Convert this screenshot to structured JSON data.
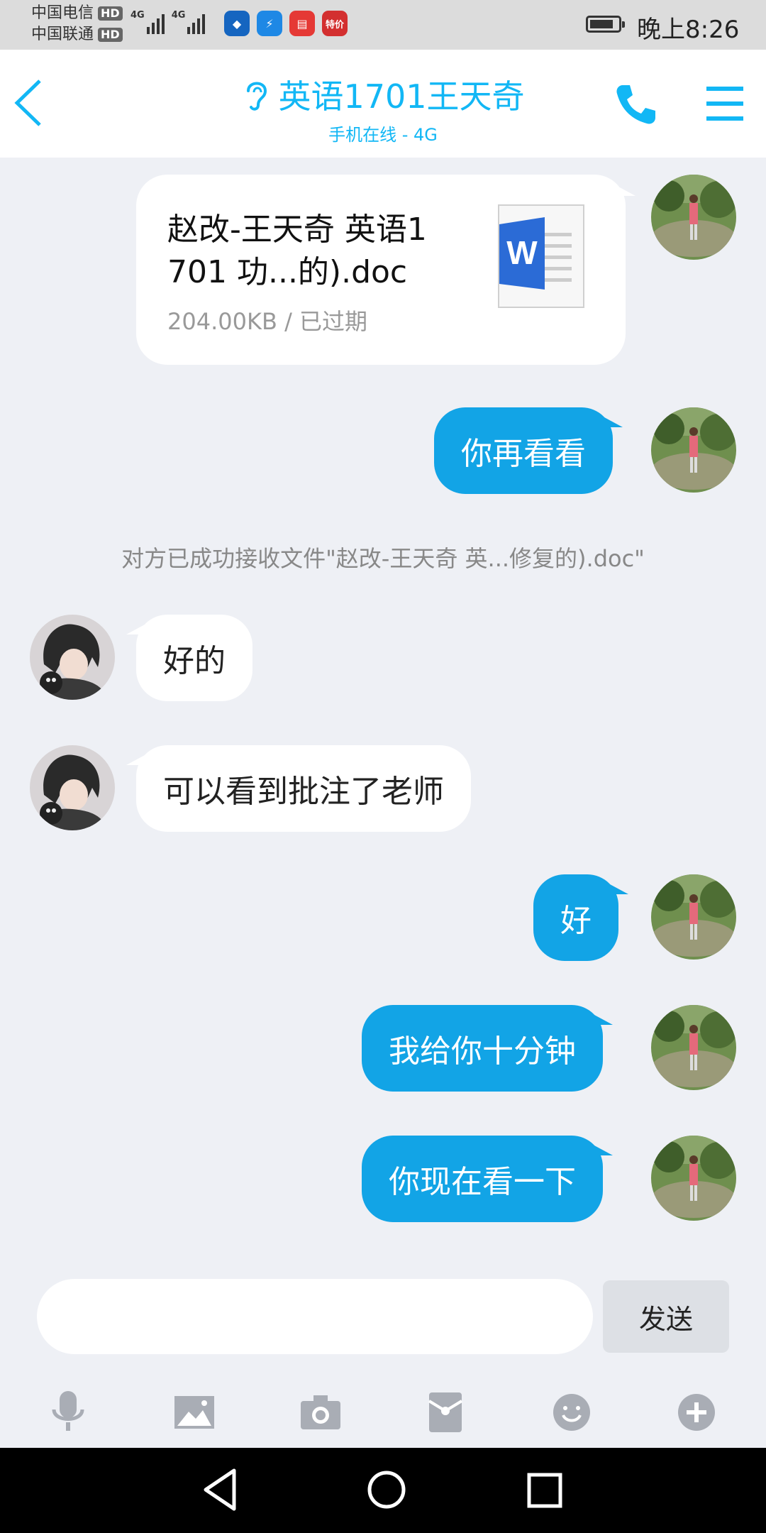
{
  "status_bar": {
    "carrier_1": "中国电信",
    "carrier_2": "中国联通",
    "hd_label": "HD",
    "network_label": "4G",
    "app_badge": "特价",
    "time": "晚上8:26"
  },
  "header": {
    "title": "英语1701王天奇",
    "subtitle": "手机在线 - 4G"
  },
  "colors": {
    "accent": "#12b7f5",
    "my_bubble": "#12a4e6",
    "their_bubble": "#ffffff",
    "background": "#eef0f5"
  },
  "messages": {
    "file": {
      "name": "赵改-王天奇 英语1\n701 功...的).doc",
      "meta": "204.00KB / 已过期",
      "icon": "word-doc-icon",
      "icon_letter": "W"
    },
    "m1": "你再看看",
    "system": "对方已成功接收文件\"赵改-王天奇 英...修复的).doc\"",
    "m2": "好的",
    "m3": "可以看到批注了老师",
    "m4": "好",
    "m5": "我给你十分钟",
    "m6": "你现在看一下"
  },
  "input": {
    "send_label": "发送"
  },
  "toolbar_icons": [
    "microphone-icon",
    "image-icon",
    "camera-icon",
    "red-packet-icon",
    "emoji-icon",
    "plus-icon"
  ],
  "nav_icons": [
    "back-icon",
    "home-icon",
    "recents-icon"
  ]
}
